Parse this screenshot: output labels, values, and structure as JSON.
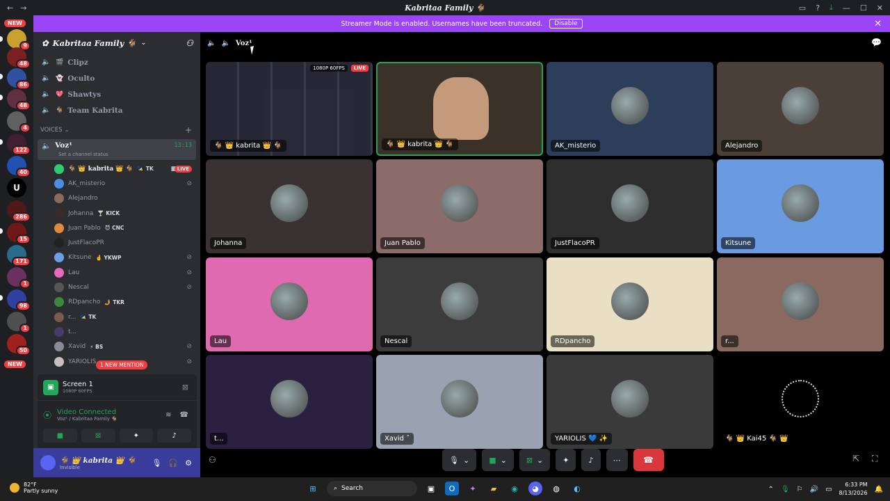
{
  "window": {
    "title": "Kabritaa Family 🐐"
  },
  "banner": {
    "text": "Streamer Mode is enabled. Usernames have been truncated.",
    "button": "Disable"
  },
  "guild_badges": {
    "new_top": "NEW",
    "new_bottom": "NEW",
    "counts": [
      "9",
      "48",
      "86",
      "48",
      "4",
      "122",
      "40",
      "",
      "286",
      "15",
      "171",
      "1",
      "98",
      "1",
      "50"
    ]
  },
  "server": {
    "name": "Kabritaa Family 🐐",
    "channels": [
      {
        "name": "Clipz",
        "emoji": "🎬"
      },
      {
        "name": "Oculto",
        "emoji": "👻"
      },
      {
        "name": "Shawtys",
        "emoji": "💖"
      },
      {
        "name": "Team Kabrita",
        "emoji": "🐐"
      }
    ],
    "category": "VOICES",
    "current_channel": {
      "name": "Voz¹",
      "status": "Set a channel status",
      "timer": "13:13"
    },
    "voice_users": [
      {
        "name": "🐐 👑 kabrita 👑 🐐",
        "tag": "🇹🇰 TK",
        "right": "LIVE",
        "color": "#2ecc71"
      },
      {
        "name": "AK_misterio",
        "tag": "",
        "right": "mute",
        "color": "#4a90e2"
      },
      {
        "name": "Alejandro",
        "tag": "",
        "right": "",
        "color": "#8a6a5a"
      },
      {
        "name": "Johanna",
        "tag": "🍸 KICK",
        "right": "",
        "color": "#3a2a2a"
      },
      {
        "name": "Juan Pablo",
        "tag": "😈 CNC",
        "right": "",
        "color": "#e08a3a"
      },
      {
        "name": "JustFlacoPR",
        "tag": "",
        "right": "",
        "color": "#222"
      },
      {
        "name": "Kitsune",
        "tag": "🤞 YKWP",
        "right": "mute",
        "color": "#6aa0e8"
      },
      {
        "name": "Lau",
        "tag": "",
        "right": "mute",
        "color": "#e86ab8"
      },
      {
        "name": "Nescal",
        "tag": "",
        "right": "mute",
        "color": "#555"
      },
      {
        "name": "RDpancho",
        "tag": "🤳 TKR",
        "right": "",
        "color": "#3a8a3a"
      },
      {
        "name": "r...",
        "tag": "🇹🇰 TK",
        "right": "",
        "color": "#7a5a4a"
      },
      {
        "name": "t...",
        "tag": "",
        "right": "",
        "color": "#4a3a6a"
      },
      {
        "name": "Xavid",
        "tag": "⚡ BS",
        "right": "mute",
        "color": "#8a8a9a"
      },
      {
        "name": "YARIOLIS",
        "tag": "",
        "right": "mute",
        "color": "#c8c0c0"
      }
    ],
    "mention": "1 NEW MENTION"
  },
  "panel": {
    "screen": {
      "title": "Screen 1",
      "sub": "1080P 60FPS"
    },
    "voice": {
      "title": "Video Connected",
      "sub": "Voz¹ / Kabritaa Family 🐐"
    }
  },
  "user": {
    "name": "🐐 👑 kabrita 👑 🐐",
    "status": "Invisible"
  },
  "stage": {
    "channel": "Voz¹",
    "tiles": [
      {
        "label": "🐐 👑 kabrita 👑 🐐",
        "bg": "#1a1a1a",
        "quality": "1080P 60FPS",
        "live": "LIVE"
      },
      {
        "label": "🐐 👑 kabrita 👑 🐐",
        "bg": "#3a3228"
      },
      {
        "label": "AK_misterio",
        "bg": "#2c3e5a"
      },
      {
        "label": "Alejandro",
        "bg": "#4a4038"
      },
      {
        "label": "Johanna",
        "bg": "#3a3232"
      },
      {
        "label": "Juan Pablo",
        "bg": "#8c6c6a"
      },
      {
        "label": "JustFlacoPR",
        "bg": "#2e2e2e"
      },
      {
        "label": "Kitsune",
        "bg": "#6a9ae0"
      },
      {
        "label": "Lau",
        "bg": "#e06ab0"
      },
      {
        "label": "Nescal",
        "bg": "#3c3c3c"
      },
      {
        "label": "RDpancho",
        "bg": "#e8dfc4"
      },
      {
        "label": "r...",
        "bg": "#8a6a60"
      },
      {
        "label": "t...",
        "bg": "#2a2040"
      },
      {
        "label": "Xavid ˆ",
        "bg": "#9aa2b2"
      },
      {
        "label": "YARIOLIS 💙 ✨",
        "bg": "#3a3a3a"
      },
      {
        "label": "🐐 👑 Kai45 🐐 👑",
        "bg": "#000000"
      }
    ]
  },
  "taskbar": {
    "temp": "82°F",
    "weather": "Partly sunny",
    "search": "Search",
    "time": "6:33 PM",
    "date": "8/13/2026"
  }
}
